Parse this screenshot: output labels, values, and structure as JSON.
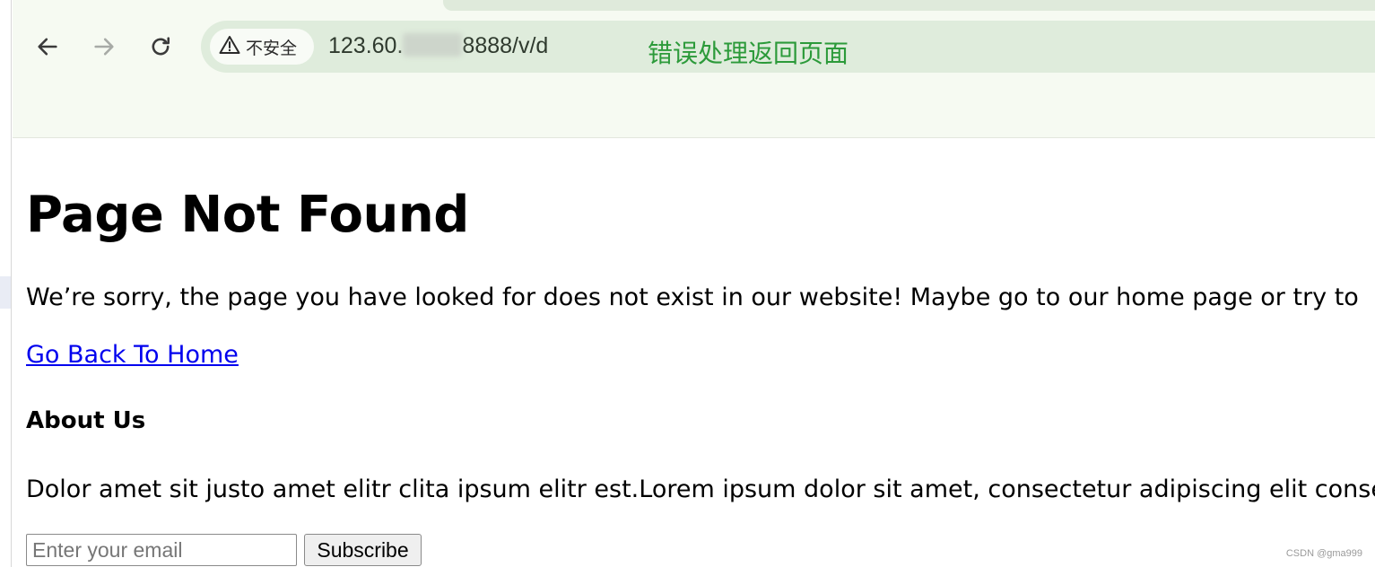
{
  "browser": {
    "security_chip": {
      "icon": "warning-triangle-icon",
      "label": "不安全"
    },
    "url": {
      "prefix": "123.60.",
      "suffix": "8888/v/d"
    },
    "nav": {
      "back_icon": "arrow-left-icon",
      "forward_icon": "arrow-right-icon",
      "reload_icon": "reload-icon"
    }
  },
  "annotation": "错误处理返回页面",
  "page": {
    "title": "Page Not Found",
    "message": "We’re sorry, the page you have looked for does not exist in our website! Maybe go to our home page or try to",
    "home_link": "Go Back To Home",
    "about_heading": "About Us",
    "about_text": "Dolor amet sit justo amet elitr clita ipsum elitr est.Lorem ipsum dolor sit amet, consectetur adipiscing elit consec",
    "email_placeholder": "Enter your email",
    "subscribe_label": "Subscribe"
  },
  "watermark": "CSDN @gma999",
  "colors": {
    "annotation": "#2c9a3a",
    "link": "#0000ee",
    "omnibox": "#dfecdc",
    "toolbar": "#f6faf2"
  }
}
